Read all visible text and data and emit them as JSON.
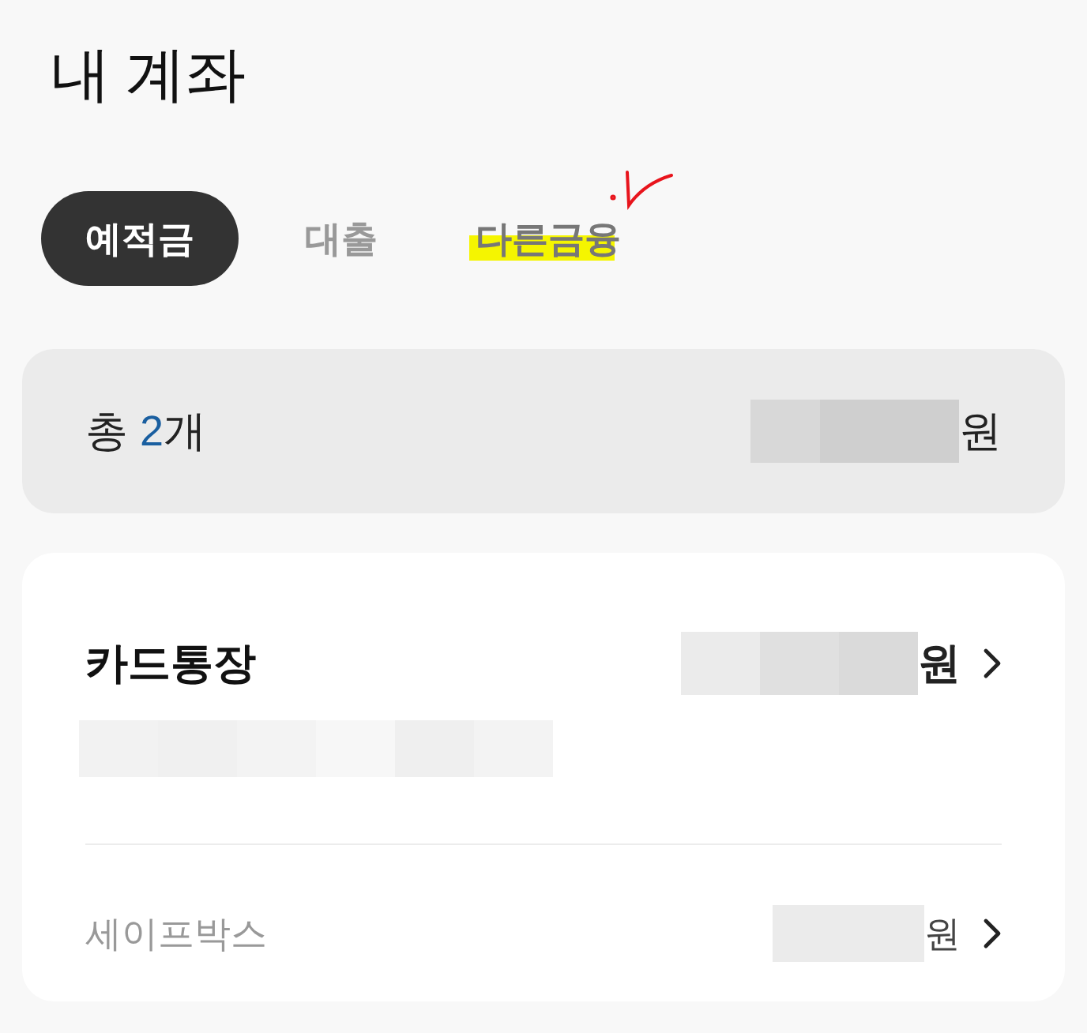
{
  "title": "내 계좌",
  "tabs": [
    {
      "label": "예적금",
      "selected": true,
      "highlighted": false
    },
    {
      "label": "대출",
      "selected": false,
      "highlighted": false
    },
    {
      "label": "다른금융",
      "selected": false,
      "highlighted": true
    }
  ],
  "summary": {
    "prefix": "총",
    "count": "2",
    "suffix": "개",
    "unit": "원"
  },
  "accounts": [
    {
      "kind": "primary",
      "name": "카드통장",
      "unit": "원"
    },
    {
      "kind": "secondary",
      "name": "세이프박스",
      "unit": "원"
    }
  ]
}
